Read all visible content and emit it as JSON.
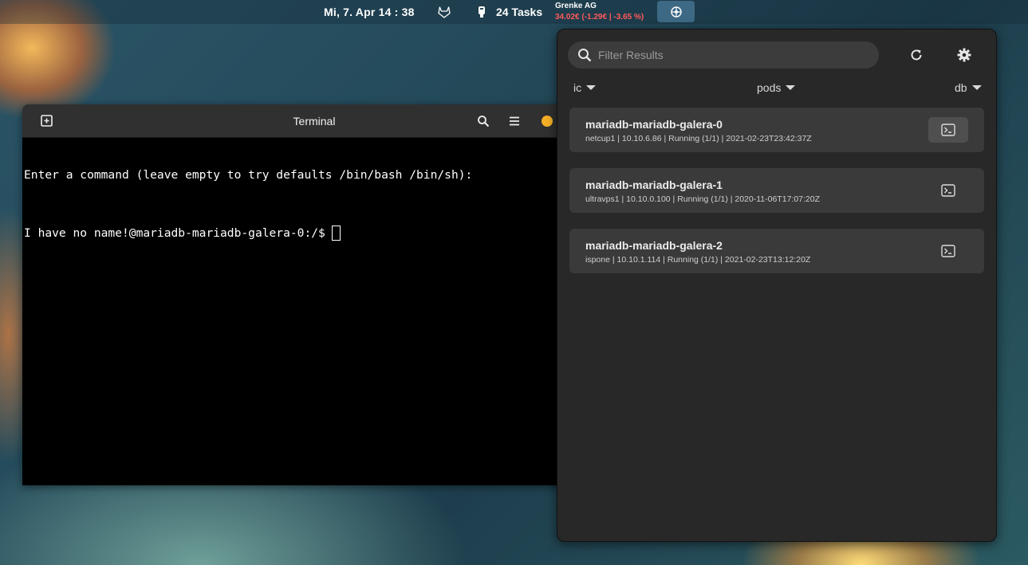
{
  "topbar": {
    "clock": "Mi, 7. Apr 14 : 38",
    "tasks": "24 Tasks",
    "stock_name": "Grenke AG",
    "stock_value": "34.02€ (-1.29€ | -3.65 %)"
  },
  "terminal": {
    "title": "Terminal",
    "line1": "Enter a command (leave empty to try defaults /bin/bash /bin/sh):",
    "prompt": "I have no name!@mariadb-mariadb-galera-0:/$"
  },
  "popup": {
    "search_placeholder": "Filter Results",
    "dropdowns": {
      "namespace": "ic",
      "type": "pods",
      "filter": "db"
    },
    "pods": [
      {
        "name": "mariadb-mariadb-galera-0",
        "info": "netcup1 | 10.10.6.86 | Running (1/1) | 2021-02-23T23:42:37Z"
      },
      {
        "name": "mariadb-mariadb-galera-1",
        "info": "ultravps1 | 10.10.0.100 | Running (1/1) | 2020-11-06T17:07:20Z"
      },
      {
        "name": "mariadb-mariadb-galera-2",
        "info": "ispone | 10.10.1.114 | Running (1/1) | 2021-02-23T13:12:20Z"
      }
    ]
  },
  "colors": {
    "accent_minimize": "#f6b025",
    "stock_negative": "#ff5a5a",
    "popup_bg": "#282828",
    "pod_card_bg": "#3a3a3a"
  },
  "icons": [
    "gitlab-icon",
    "tasks-icon",
    "extension-icon",
    "new-tab-icon",
    "search-icon",
    "menu-icon",
    "refresh-icon",
    "gear-icon",
    "terminal-icon"
  ]
}
